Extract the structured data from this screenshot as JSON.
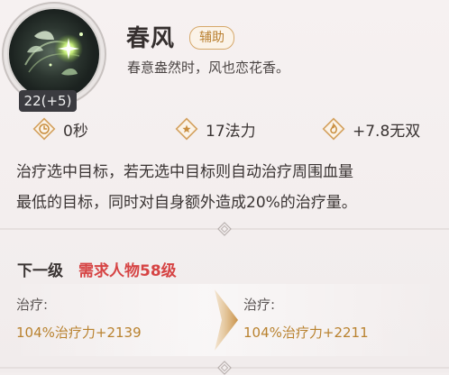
{
  "skill": {
    "name": "春风",
    "tag": "辅助",
    "quote": "春意盎然时，风也恋花香。",
    "level": "22(+5)"
  },
  "stats": [
    {
      "icon": "clock-icon",
      "value": "0秒"
    },
    {
      "icon": "star-icon",
      "value": "17法力"
    },
    {
      "icon": "flame-icon",
      "value": "+7.8无双"
    }
  ],
  "description": {
    "line1": "治疗选中目标，若无选中目标则自动治疗周围血量",
    "line2": "最低的目标，同时对自身额外造成20%的治疗量。"
  },
  "next_level": {
    "title": "下一级",
    "requirement": "需求人物58级",
    "current_label": "治疗:",
    "current_value": "104%治疗力+2139",
    "next_label": "治疗:",
    "next_value": "104%治疗力+2211"
  },
  "colors": {
    "accent_gold": "#b9822f",
    "requirement_red": "#d64444",
    "tag_border": "#d6a86a"
  }
}
